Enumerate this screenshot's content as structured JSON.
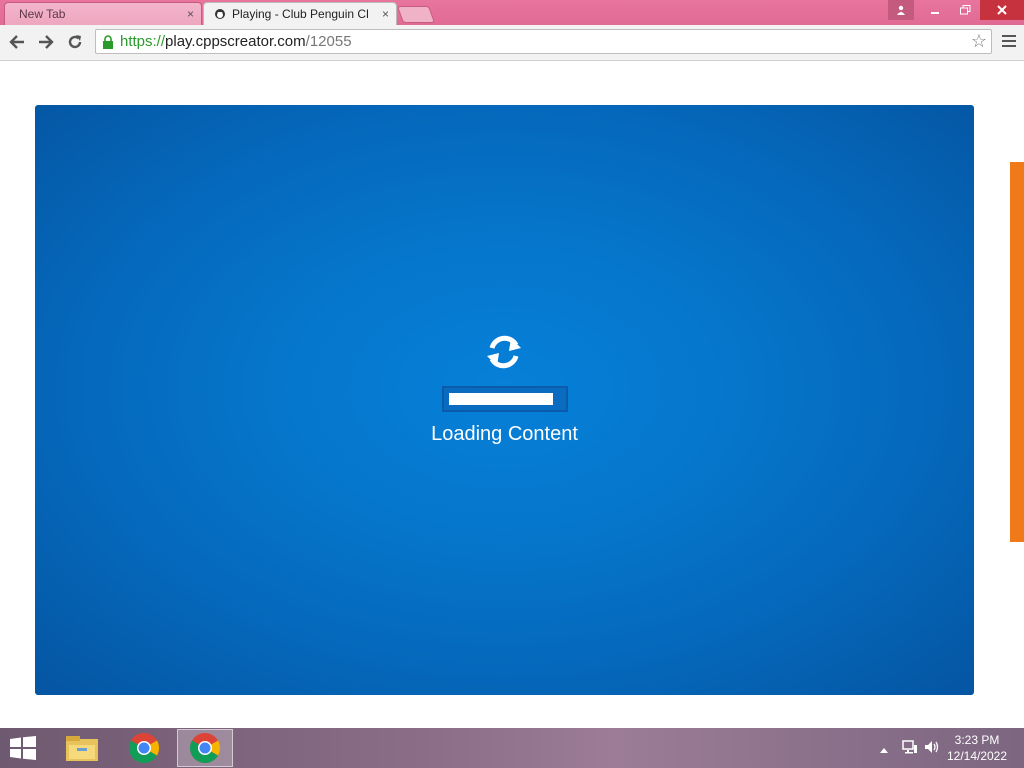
{
  "browser": {
    "tabs": [
      {
        "label": "New Tab",
        "close": "×"
      },
      {
        "label": "Playing - Club Penguin Cl",
        "close": "×"
      }
    ],
    "url": {
      "scheme": "https://",
      "host": "play.cppscreator.com",
      "path": "/12055"
    }
  },
  "game": {
    "loading_text": "Loading Content",
    "progress_fraction": 0.93
  },
  "taskbar": {
    "time": "3:23 PM",
    "date": "12/14/2022"
  },
  "icons": [
    "back-icon",
    "forward-icon",
    "reload-icon",
    "lock-icon",
    "star-icon",
    "menu-icon",
    "refresh-icon",
    "windows-start-icon",
    "file-explorer-icon",
    "chrome-icon"
  ],
  "colors": {
    "game_blue": "#0576cb",
    "accent_orange": "#f07a1a",
    "titlebar_pink": "#e06a93"
  }
}
